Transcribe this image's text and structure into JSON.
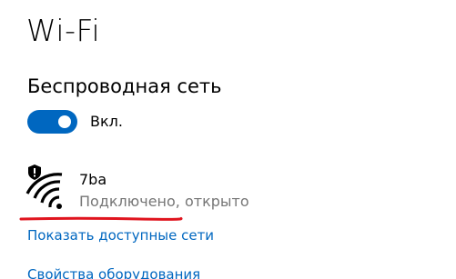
{
  "page": {
    "title": "Wi-Fi",
    "section_heading": "Беспроводная сеть"
  },
  "wifi_toggle": {
    "state_label": "Вкл.",
    "on": true,
    "accent_color": "#0067c0"
  },
  "network": {
    "name": "7ba",
    "status": "Подключено, открыто",
    "icon": "wifi-shield-icon"
  },
  "annotation": {
    "underline_color": "#e0141e"
  },
  "links": {
    "show_available": "Показать доступные сети",
    "hardware_properties": "Свойства оборудования"
  }
}
